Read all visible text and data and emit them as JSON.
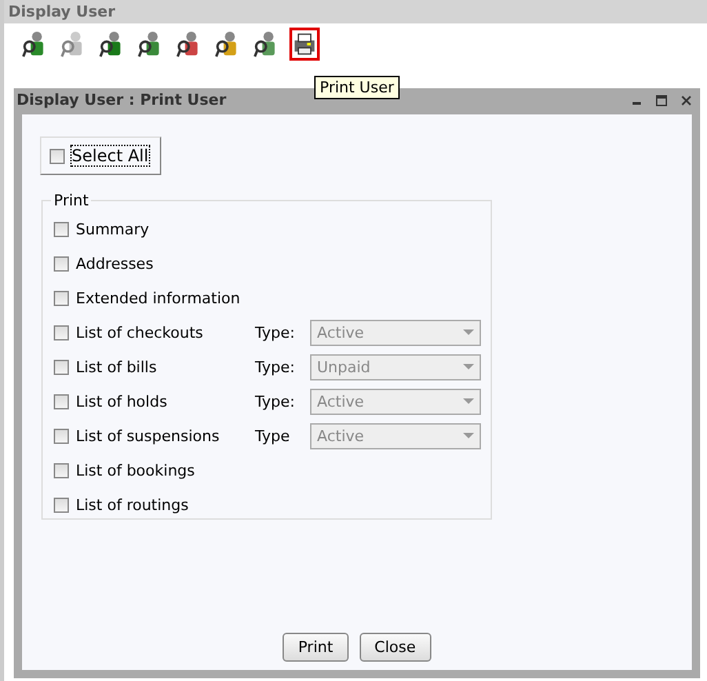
{
  "page": {
    "title": "Display User"
  },
  "toolbar": [
    {
      "disabled": false,
      "selected": false
    },
    {
      "disabled": true,
      "selected": false
    },
    {
      "disabled": false,
      "selected": false
    },
    {
      "disabled": false,
      "selected": false
    },
    {
      "disabled": false,
      "selected": false
    },
    {
      "disabled": false,
      "selected": false
    },
    {
      "disabled": false,
      "selected": false
    },
    {
      "disabled": false,
      "selected": true
    }
  ],
  "tooltip": "Print User",
  "dialog": {
    "title": "Display User : Print User",
    "select_all": {
      "label": "Select All",
      "checked": false
    },
    "group": "Print",
    "options": [
      {
        "kind": "checkbox",
        "label": "Summary",
        "checked": false
      },
      {
        "kind": "checkbox",
        "label": "Addresses",
        "checked": false
      },
      {
        "kind": "checkbox",
        "label": "Extended information",
        "checked": false
      },
      {
        "kind": "select",
        "label": "List of checkouts",
        "checked": false,
        "type_label": "Type:",
        "value": "Active",
        "disabled": true
      },
      {
        "kind": "select",
        "label": "List of bills",
        "checked": false,
        "type_label": "Type:",
        "value": "Unpaid",
        "disabled": true
      },
      {
        "kind": "select",
        "label": "List of holds",
        "checked": false,
        "type_label": "Type:",
        "value": "Active",
        "disabled": true
      },
      {
        "kind": "select",
        "label": "List of suspensions",
        "checked": false,
        "type_label": "Type",
        "value": "Active",
        "disabled": true
      },
      {
        "kind": "checkbox",
        "label": "List of bookings",
        "checked": false
      },
      {
        "kind": "checkbox",
        "label": "List of routings",
        "checked": false
      }
    ],
    "buttons": [
      "Print",
      "Close"
    ]
  }
}
